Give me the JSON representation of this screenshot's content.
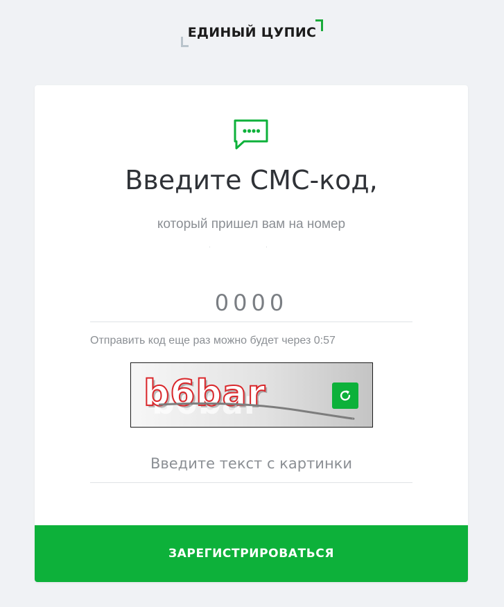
{
  "logo": {
    "text": "ЕДИНЫЙ ЦУПИС"
  },
  "icons": {
    "sms": "sms-chat-icon",
    "refresh": "refresh-icon"
  },
  "colors": {
    "accent": "#0db13a",
    "captcha_text": "#d9262a"
  },
  "form": {
    "title": "Введите СМС-код,",
    "subtitle": "который пришел вам на номер",
    "masked_phone": "· ·",
    "code_placeholder": "0000",
    "resend_text": "Отправить код еще раз можно будет через 0:57",
    "captcha_text": "b6bar",
    "captcha_placeholder": "Введите текст с картинки",
    "submit_label": "ЗАРЕГИСТРИРОВАТЬСЯ"
  }
}
